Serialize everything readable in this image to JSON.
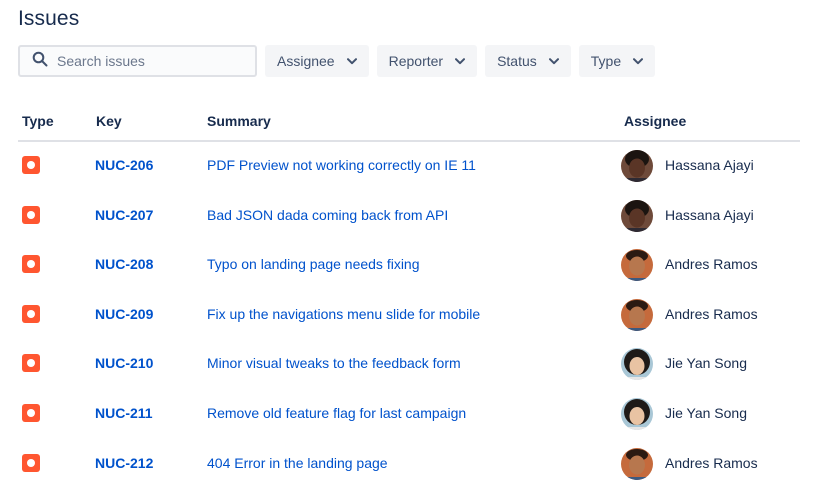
{
  "page": {
    "title": "Issues"
  },
  "search": {
    "placeholder": "Search issues",
    "value": ""
  },
  "filters": [
    {
      "label": "Assignee"
    },
    {
      "label": "Reporter"
    },
    {
      "label": "Status"
    },
    {
      "label": "Type"
    }
  ],
  "table": {
    "columns": {
      "type": "Type",
      "key": "Key",
      "summary": "Summary",
      "assignee": "Assignee"
    },
    "rows": [
      {
        "type_icon": "bug-icon",
        "key": "NUC-206",
        "summary": "PDF Preview not working correctly on IE 11",
        "assignee": "Hassana Ajayi"
      },
      {
        "type_icon": "bug-icon",
        "key": "NUC-207",
        "summary": "Bad JSON dada coming back from API",
        "assignee": "Hassana Ajayi"
      },
      {
        "type_icon": "bug-icon",
        "key": "NUC-208",
        "summary": "Typo on landing page needs fixing",
        "assignee": "Andres Ramos"
      },
      {
        "type_icon": "bug-icon",
        "key": "NUC-209",
        "summary": "Fix up the navigations menu slide for mobile",
        "assignee": "Andres Ramos"
      },
      {
        "type_icon": "bug-icon",
        "key": "NUC-210",
        "summary": "Minor visual tweaks to the feedback form",
        "assignee": "Jie Yan Song"
      },
      {
        "type_icon": "bug-icon",
        "key": "NUC-211",
        "summary": "Remove old feature flag for last campaign",
        "assignee": "Jie Yan Song"
      },
      {
        "type_icon": "bug-icon",
        "key": "NUC-212",
        "summary": "404 Error in the landing page",
        "assignee": "Andres Ramos"
      }
    ]
  },
  "colors": {
    "link": "#0052CC",
    "text": "#172B4D",
    "bug": "#FF5630",
    "filter_bg": "#F4F5F7",
    "border": "#DFE1E6"
  }
}
